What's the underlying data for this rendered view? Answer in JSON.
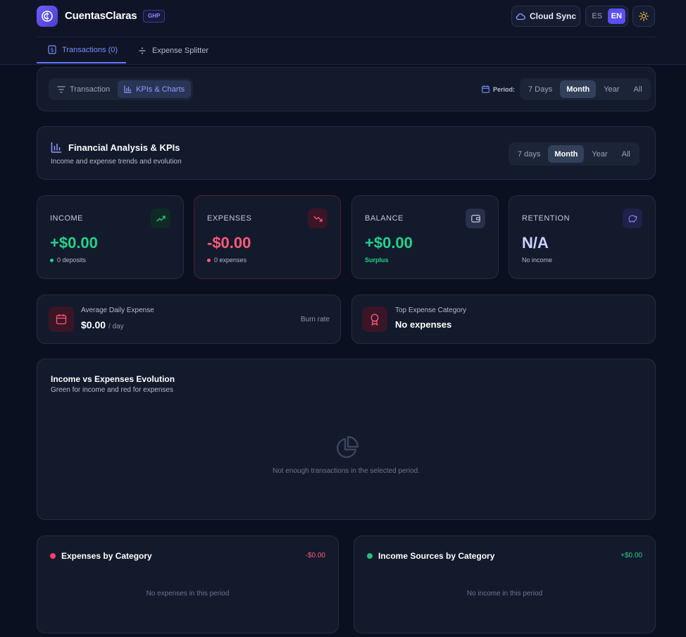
{
  "header": {
    "app_title": "CuentasClaras",
    "app_badge": "GHP",
    "cloud_sync": "Cloud Sync",
    "lang_es": "ES",
    "lang_en": "EN",
    "tabs": [
      {
        "label": "Transactions (0)",
        "active": true
      },
      {
        "label": "Expense Splitter",
        "active": false
      }
    ]
  },
  "toolbar": {
    "views": [
      {
        "label": "Transaction",
        "active": false
      },
      {
        "label": "KPIs & Charts",
        "active": true
      }
    ],
    "period_label": "Period:",
    "periods": [
      {
        "label": "7 Days",
        "active": false
      },
      {
        "label": "Month",
        "active": true
      },
      {
        "label": "Year",
        "active": false
      },
      {
        "label": "All",
        "active": false
      }
    ]
  },
  "analysis": {
    "title": "Financial Analysis & KPIs",
    "subtitle": "Income and expense trends and evolution",
    "periods": [
      {
        "label": "7 days",
        "active": false
      },
      {
        "label": "Month",
        "active": true
      },
      {
        "label": "Year",
        "active": false
      },
      {
        "label": "All",
        "active": false
      }
    ]
  },
  "kpis": {
    "income": {
      "label": "INCOME",
      "value": "+$0.00",
      "sub": "0 deposits"
    },
    "expenses": {
      "label": "EXPENSES",
      "value": "-$0.00",
      "sub": "0 expenses"
    },
    "balance": {
      "label": "BALANCE",
      "value": "+$0.00",
      "sub": "Surplus"
    },
    "retention": {
      "label": "RETENTION",
      "value": "N/A",
      "sub": "No income"
    }
  },
  "stats": {
    "avg_daily": {
      "label": "Average Daily Expense",
      "value": "$0.00",
      "unit": "/ day",
      "note": "Burn rate"
    },
    "top_category": {
      "label": "Top Expense Category",
      "value": "No expenses"
    }
  },
  "evolution": {
    "title": "Income vs Expenses Evolution",
    "subtitle": "Green for income and red for expenses",
    "empty": "Not enough transactions in the selected period."
  },
  "expenses_by_category": {
    "title": "Expenses by Category",
    "total": "-$0.00",
    "empty": "No expenses in this period"
  },
  "income_by_category": {
    "title": "Income Sources by Category",
    "total": "+$0.00",
    "empty": "No income in this period"
  },
  "colors": {
    "accent": "#6374ff",
    "income": "#22d38a",
    "expense": "#ff5a79",
    "retention": "#c9d1ff"
  }
}
